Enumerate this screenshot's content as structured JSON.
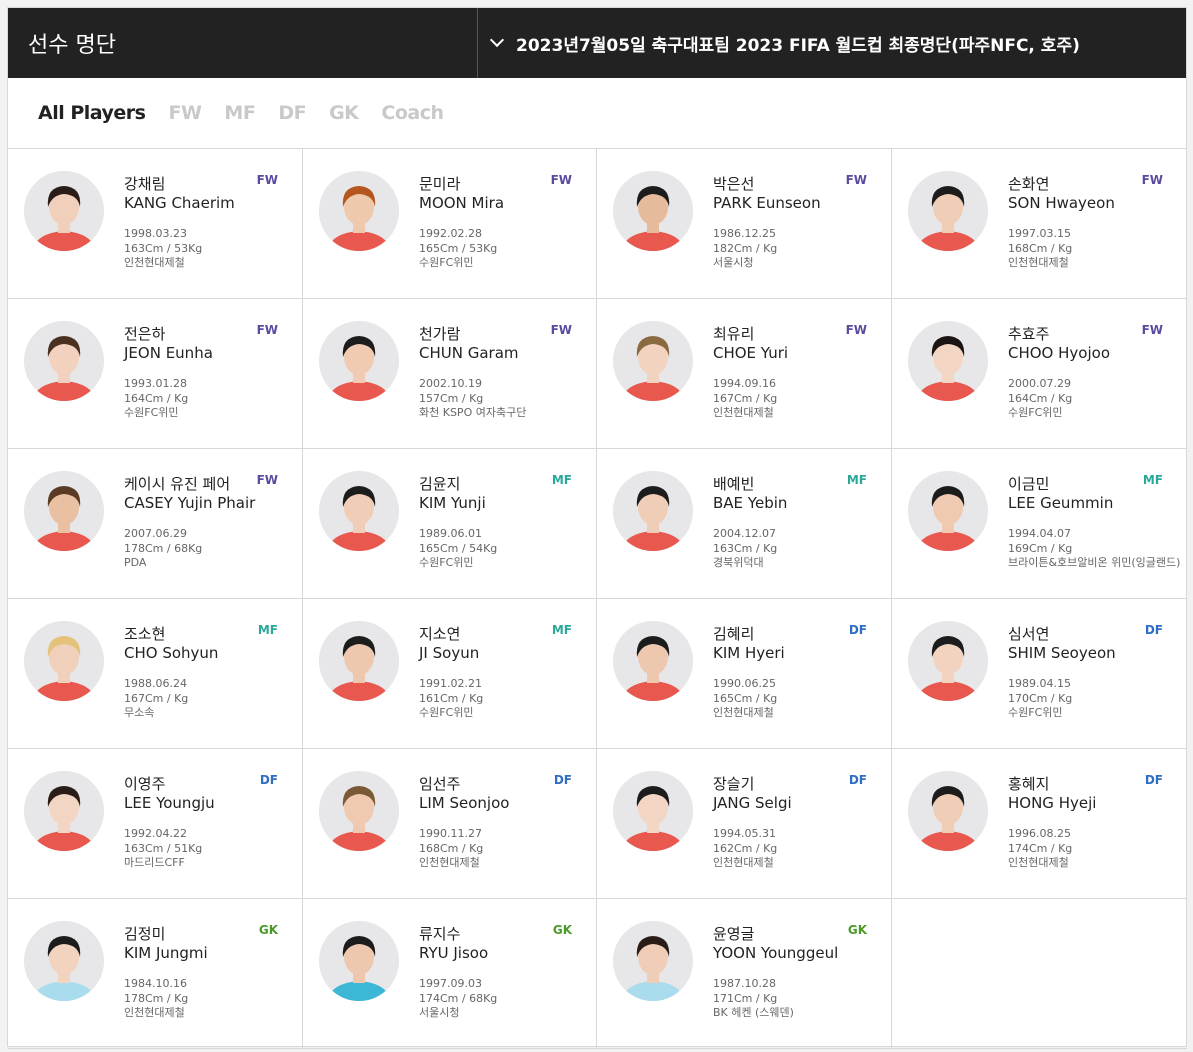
{
  "header": {
    "title": "선수 명단",
    "roster_select": "2023년7월05일 축구대표팀 2023 FIFA 월드컵 최종명단(파주NFC, 호주)"
  },
  "tabs": [
    "All Players",
    "FW",
    "MF",
    "DF",
    "GK",
    "Coach"
  ],
  "position_colors": {
    "FW": "#5b4a9e",
    "MF": "#2aa89a",
    "DF": "#2f6ec4",
    "GK": "#4a9a2a"
  },
  "players": [
    {
      "kname": "강채림",
      "ename": "KANG Chaerim",
      "pos": "FW",
      "dob": "1998.03.23",
      "body": "163Cm / 53Kg",
      "club": "인천현대제철",
      "hair": "#2a1d17",
      "skin": "#f1d0bb",
      "kit": "#e8584f"
    },
    {
      "kname": "문미라",
      "ename": "MOON Mira",
      "pos": "FW",
      "dob": "1992.02.28",
      "body": "165Cm / 53Kg",
      "club": "수원FC위민",
      "hair": "#b5561f",
      "skin": "#efc9ad",
      "kit": "#e8584f"
    },
    {
      "kname": "박은선",
      "ename": "PARK Eunseon",
      "pos": "FW",
      "dob": "1986.12.25",
      "body": "182Cm / Kg",
      "club": "서울시청",
      "hair": "#1c1c1c",
      "skin": "#e6bb9c",
      "kit": "#e8584f"
    },
    {
      "kname": "손화연",
      "ename": "SON Hwayeon",
      "pos": "FW",
      "dob": "1997.03.15",
      "body": "168Cm / Kg",
      "club": "인천현대제철",
      "hair": "#1c1c1c",
      "skin": "#f0cdb6",
      "kit": "#e8584f"
    },
    {
      "kname": "전은하",
      "ename": "JEON Eunha",
      "pos": "FW",
      "dob": "1993.01.28",
      "body": "164Cm / Kg",
      "club": "수원FC위민",
      "hair": "#4a3020",
      "skin": "#f2d2bf",
      "kit": "#e8584f"
    },
    {
      "kname": "천가람",
      "ename": "CHUN Garam",
      "pos": "FW",
      "dob": "2002.10.19",
      "body": "157Cm / Kg",
      "club": "화천 KSPO 여자축구단",
      "hair": "#1c1c1c",
      "skin": "#f0cbb1",
      "kit": "#e8584f"
    },
    {
      "kname": "최유리",
      "ename": "CHOE Yuri",
      "pos": "FW",
      "dob": "1994.09.16",
      "body": "167Cm / Kg",
      "club": "인천현대제철",
      "hair": "#8a6a40",
      "skin": "#f2d3bf",
      "kit": "#e8584f"
    },
    {
      "kname": "추효주",
      "ename": "CHOO Hyojoo",
      "pos": "FW",
      "dob": "2000.07.29",
      "body": "164Cm / Kg",
      "club": "수원FC위민",
      "hair": "#1a1512",
      "skin": "#f3d5c3",
      "kit": "#e8584f"
    },
    {
      "kname": "케이시 유진 페어",
      "ename": "CASEY Yujin Phair",
      "pos": "FW",
      "dob": "2007.06.29",
      "body": "178Cm / 68Kg",
      "club": "PDA",
      "hair": "#5a3a22",
      "skin": "#e9c0a2",
      "kit": "#e8584f"
    },
    {
      "kname": "김윤지",
      "ename": "KIM Yunji",
      "pos": "MF",
      "dob": "1989.06.01",
      "body": "165Cm / 54Kg",
      "club": "수원FC위민",
      "hair": "#1c1c1c",
      "skin": "#f0cdb6",
      "kit": "#e8584f"
    },
    {
      "kname": "배예빈",
      "ename": "BAE Yebin",
      "pos": "MF",
      "dob": "2004.12.07",
      "body": "163Cm / Kg",
      "club": "경북위덕대",
      "hair": "#1c1c1c",
      "skin": "#f0cdb6",
      "kit": "#e8584f"
    },
    {
      "kname": "이금민",
      "ename": "LEE Geummin",
      "pos": "MF",
      "dob": "1994.04.07",
      "body": "169Cm / Kg",
      "club": "브라이튼&호브알비온 위민(잉글랜드)",
      "hair": "#1c1c1c",
      "skin": "#efc9b0",
      "kit": "#e8584f"
    },
    {
      "kname": "조소현",
      "ename": "CHO Sohyun",
      "pos": "MF",
      "dob": "1988.06.24",
      "body": "167Cm / Kg",
      "club": "무소속",
      "hair": "#e4c27a",
      "skin": "#f1d0bb",
      "kit": "#e8584f"
    },
    {
      "kname": "지소연",
      "ename": "JI Soyun",
      "pos": "MF",
      "dob": "1991.02.21",
      "body": "161Cm / Kg",
      "club": "수원FC위민",
      "hair": "#1c1c1c",
      "skin": "#eec8ae",
      "kit": "#e8584f"
    },
    {
      "kname": "김혜리",
      "ename": "KIM Hyeri",
      "pos": "DF",
      "dob": "1990.06.25",
      "body": "165Cm / Kg",
      "club": "인천현대제철",
      "hair": "#1c1c1c",
      "skin": "#eec8ae",
      "kit": "#e8584f"
    },
    {
      "kname": "심서연",
      "ename": "SHIM Seoyeon",
      "pos": "DF",
      "dob": "1989.04.15",
      "body": "170Cm / Kg",
      "club": "수원FC위민",
      "hair": "#1c1c1c",
      "skin": "#f2d3c0",
      "kit": "#e8584f"
    },
    {
      "kname": "이영주",
      "ename": "LEE Youngju",
      "pos": "DF",
      "dob": "1992.04.22",
      "body": "163Cm / 51Kg",
      "club": "마드리드CFF",
      "hair": "#2a1d17",
      "skin": "#f3d5c3",
      "kit": "#e8584f"
    },
    {
      "kname": "임선주",
      "ename": "LIM Seonjoo",
      "pos": "DF",
      "dob": "1990.11.27",
      "body": "168Cm / Kg",
      "club": "인천현대제철",
      "hair": "#7a5a35",
      "skin": "#efc9b0",
      "kit": "#e8584f"
    },
    {
      "kname": "장슬기",
      "ename": "JANG Selgi",
      "pos": "DF",
      "dob": "1994.05.31",
      "body": "162Cm / Kg",
      "club": "인천현대제철",
      "hair": "#1c1c1c",
      "skin": "#f3d5c3",
      "kit": "#e8584f"
    },
    {
      "kname": "홍혜지",
      "ename": "HONG Hyeji",
      "pos": "DF",
      "dob": "1996.08.25",
      "body": "174Cm / Kg",
      "club": "인천현대제철",
      "hair": "#1c1c1c",
      "skin": "#f0cdb6",
      "kit": "#e8584f"
    },
    {
      "kname": "김정미",
      "ename": "KIM Jungmi",
      "pos": "GK",
      "dob": "1984.10.16",
      "body": "178Cm / Kg",
      "club": "인천현대제철",
      "hair": "#1c1c1c",
      "skin": "#f2d3c0",
      "kit": "#a9dcec"
    },
    {
      "kname": "류지수",
      "ename": "RYU Jisoo",
      "pos": "GK",
      "dob": "1997.09.03",
      "body": "174Cm / 68Kg",
      "club": "서울시청",
      "hair": "#1c1c1c",
      "skin": "#eec8ae",
      "kit": "#3cb7d6"
    },
    {
      "kname": "윤영글",
      "ename": "YOON Younggeul",
      "pos": "GK",
      "dob": "1987.10.28",
      "body": "171Cm / Kg",
      "club": "BK 헤켄 (스웨덴)",
      "hair": "#2a1d17",
      "skin": "#f0cdb6",
      "kit": "#a9dcec"
    }
  ]
}
